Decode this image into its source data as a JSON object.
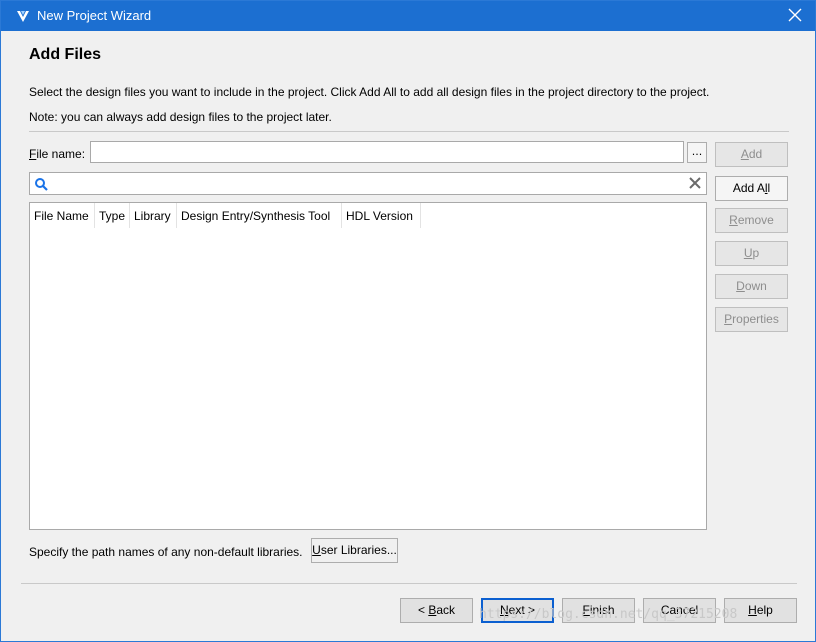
{
  "window": {
    "title": "New Project Wizard",
    "accent_color": "#1c6fd1",
    "title_icon": "vivado-logo-icon",
    "close_icon": "close-icon"
  },
  "page": {
    "title": "Add Files",
    "description": "Select the design files you want to include in the project. Click Add All to add all design files in the project directory to the project.",
    "note": "Note: you can always add design files to the project later."
  },
  "file_name": {
    "label": "File name:",
    "value": "",
    "browse_label": "..."
  },
  "search": {
    "value": "",
    "icon": "search-icon",
    "clear_icon": "clear-icon"
  },
  "table": {
    "columns": [
      "File Name",
      "Type",
      "Library",
      "Design Entry/Synthesis Tool",
      "HDL Version"
    ],
    "rows": []
  },
  "side_buttons": [
    {
      "label": "Add",
      "enabled": false
    },
    {
      "label": "Add All",
      "enabled": true
    },
    {
      "label": "Remove",
      "enabled": false
    },
    {
      "label": "Up",
      "enabled": false
    },
    {
      "label": "Down",
      "enabled": false
    },
    {
      "label": "Properties",
      "enabled": false
    }
  ],
  "libraries": {
    "text": "Specify the path names of any non-default libraries.",
    "button_label": "User Libraries..."
  },
  "nav": {
    "back": "< Back",
    "next": "Next >",
    "finish": "Finish",
    "cancel": "Cancel",
    "help": "Help"
  },
  "watermark": "https://blog.csdn.net/qq_37215208"
}
